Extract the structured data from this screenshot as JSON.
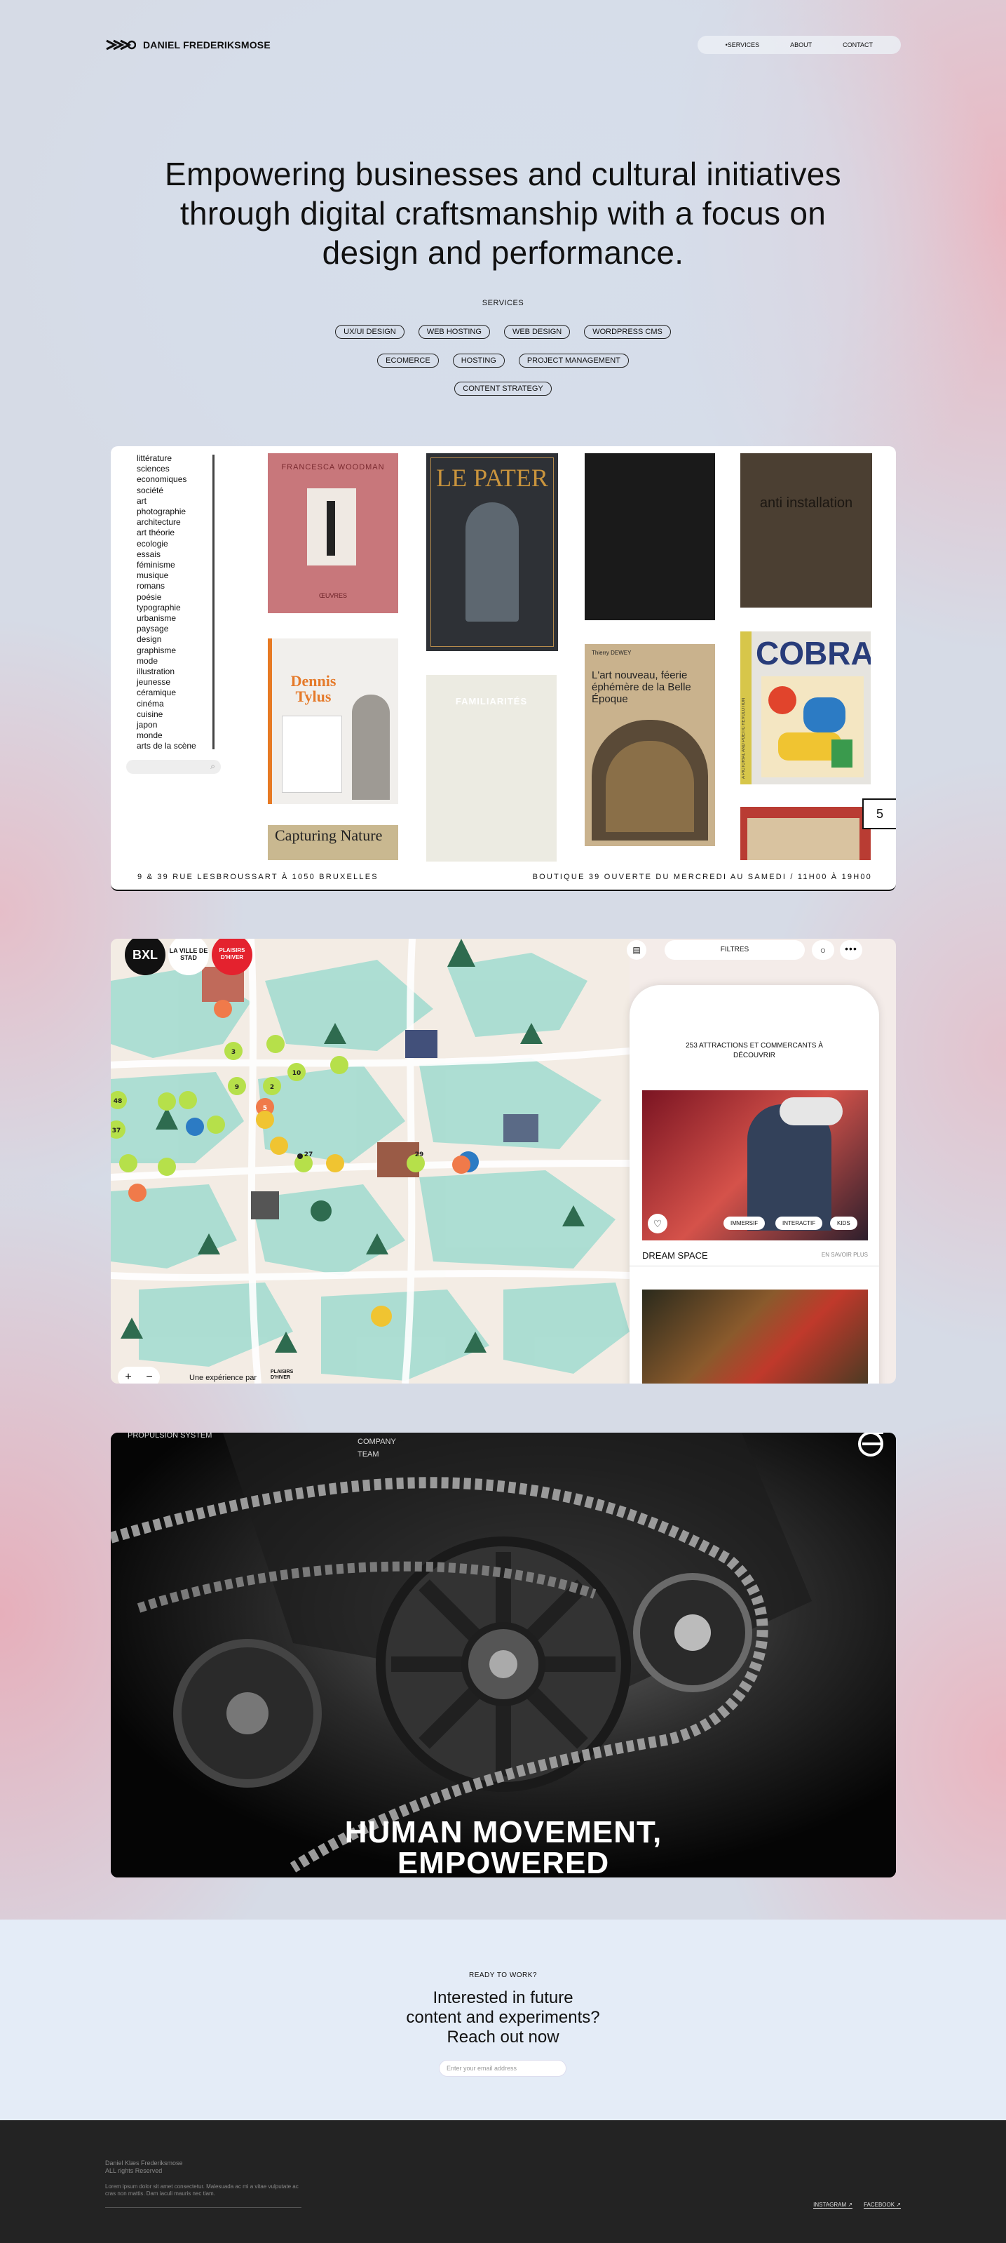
{
  "header": {
    "brand": "DANIEL FREDERIKSMOSE",
    "nav": [
      "•SERVICES",
      "ABOUT",
      "CONTACT"
    ]
  },
  "hero": {
    "headline_lines": [
      "Empowering businesses and cultural initiatives",
      "through digital craftsmanship with a focus on",
      "design and performance."
    ],
    "services_label": "SERVICES",
    "services_row1": [
      "UX/UI DESIGN",
      "WEB HOSTING",
      "WEB DESIGN",
      "WORDPRESS CMS"
    ],
    "services_row2": [
      "ECOMERCE",
      "HOSTING",
      "PROJECT MANAGEMENT"
    ],
    "services_row3": [
      "CONTENT STRATEGY"
    ]
  },
  "bookstore": {
    "categories": [
      "littérature",
      "sciences",
      "economiques",
      "société",
      "art",
      "photographie",
      "architecture",
      "art théorie",
      "ecologie",
      "essais",
      "féminisme",
      "musique",
      "romans",
      "poésie",
      "typographie",
      "urbanisme",
      "paysage",
      "design",
      "graphisme",
      "mode",
      "illustration",
      "jeunesse",
      "céramique",
      "cinéma",
      "cuisine",
      "japon",
      "monde",
      "arts de la scène"
    ],
    "books": {
      "woodman_author": "FRANCESCA WOODMAN",
      "woodman_sub": "ŒUVRES",
      "pater_title": "LE PATER",
      "anti_title": "anti   installation",
      "tylus_title": "Dennis Tylus",
      "fmt_title": "FAMILIARITÉS",
      "artnouveau_author": "Thierry DEWEY",
      "artnouveau_title": "L'art nouveau, féerie éphémère de la Belle Époque",
      "cobra_title": "COBRA",
      "cobra_side": "A PICTORIAL AND POETIC REVOLUTION",
      "capturing_title": "Capturing Nature"
    },
    "counter": "5",
    "footer_left": "9 & 39 RUE LESBROUSSART À 1050 BRUXELLES",
    "footer_right": "BOUTIQUE 39 OUVERTE DU MERCREDI AU SAMEDI / 11H00 À 19H00"
  },
  "map": {
    "logo_bxl": "BXL",
    "logo_ville": "LA VILLE DE STAD",
    "logo_plaisirs": "PLAISIRS D'HIVER",
    "filters": "FILTRES",
    "panel_title": "253 ATTRACTIONS ET COMMERCANTS À DÉCOUVRIR",
    "tags": [
      "IMMERSIF",
      "INTERACTIF",
      "KIDS"
    ],
    "item_name": "DREAM SPACE",
    "item_link": "EN SAVOIR PLUS",
    "credit": "Une expérience par",
    "credit_brand": "PLAISIRS D'HIVER",
    "numbers": [
      "3",
      "10",
      "5",
      "2",
      "9",
      "48",
      "37",
      "29",
      "27",
      "1",
      "3"
    ]
  },
  "bike": {
    "label_left": "PROPULSION SYSTEM",
    "label_company": "COMPANY",
    "label_team": "TEAM",
    "headline_lines": [
      "HUMAN MOVEMENT,",
      "EMPOWERED"
    ]
  },
  "contact": {
    "ready": "READY TO WORK?",
    "headline_lines": [
      "Interested in future",
      "content and experiments?",
      "Reach out now"
    ],
    "email_placeholder": "Enter your email address"
  },
  "footer": {
    "name": "Daniel Klæs Frederiksmose",
    "rights": "ALL rights Reserved",
    "lorem": "Lorem ipsum dolor sit amet consectetur. Malesuada ac mi a vitae vulputate ac cras non mattis. Dam iaculi mauris nec tiam.",
    "social": [
      "INSTAGRAM ↗",
      "FACEBOOK ↗"
    ]
  },
  "colors": {
    "map_water": "#a9ddd2",
    "map_marker_green": "#b6e04a",
    "map_marker_orange": "#f07a4a",
    "bxl_red": "#e4222e"
  }
}
